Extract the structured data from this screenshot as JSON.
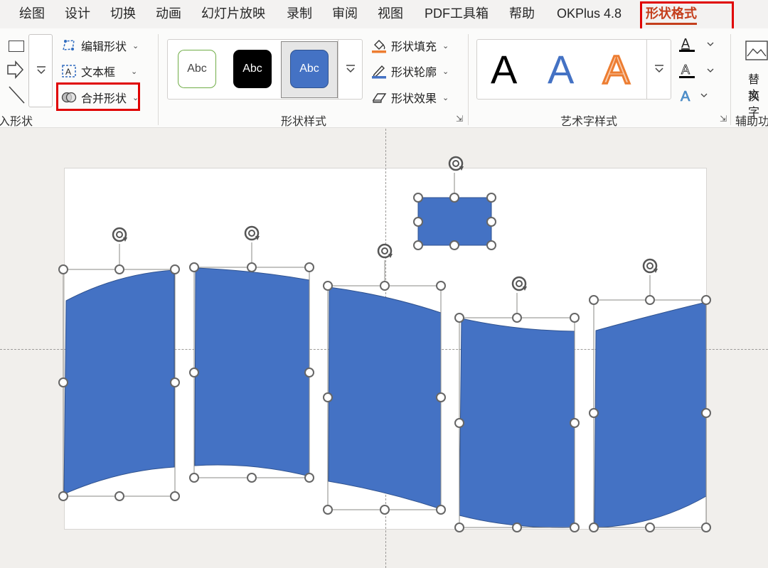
{
  "menu": {
    "items": [
      "绘图",
      "设计",
      "切换",
      "动画",
      "幻灯片放映",
      "录制",
      "审阅",
      "视图",
      "PDF工具箱",
      "帮助",
      "OKPlus 4.8"
    ],
    "active": "形状格式"
  },
  "insert_shapes": {
    "edit_shape": "编辑形状",
    "text_box": "文本框",
    "merge_shapes": "合并形状",
    "group_label": "入形状"
  },
  "shape_styles": {
    "tile_text": "Abc",
    "fill": "形状填充",
    "outline": "形状轮廓",
    "effects": "形状效果",
    "group_label": "形状样式"
  },
  "wordart": {
    "letter": "A",
    "group_label": "艺术字样式"
  },
  "accessibility": {
    "alt_text_line1": "替换",
    "alt_text_line2": "文字",
    "group_label": "辅助功"
  },
  "colors": {
    "accent_red": "#e00000",
    "shape_fill": "#4472c4",
    "active_tab": "#c43e1c",
    "wordart_orange": "#ed7d31"
  }
}
